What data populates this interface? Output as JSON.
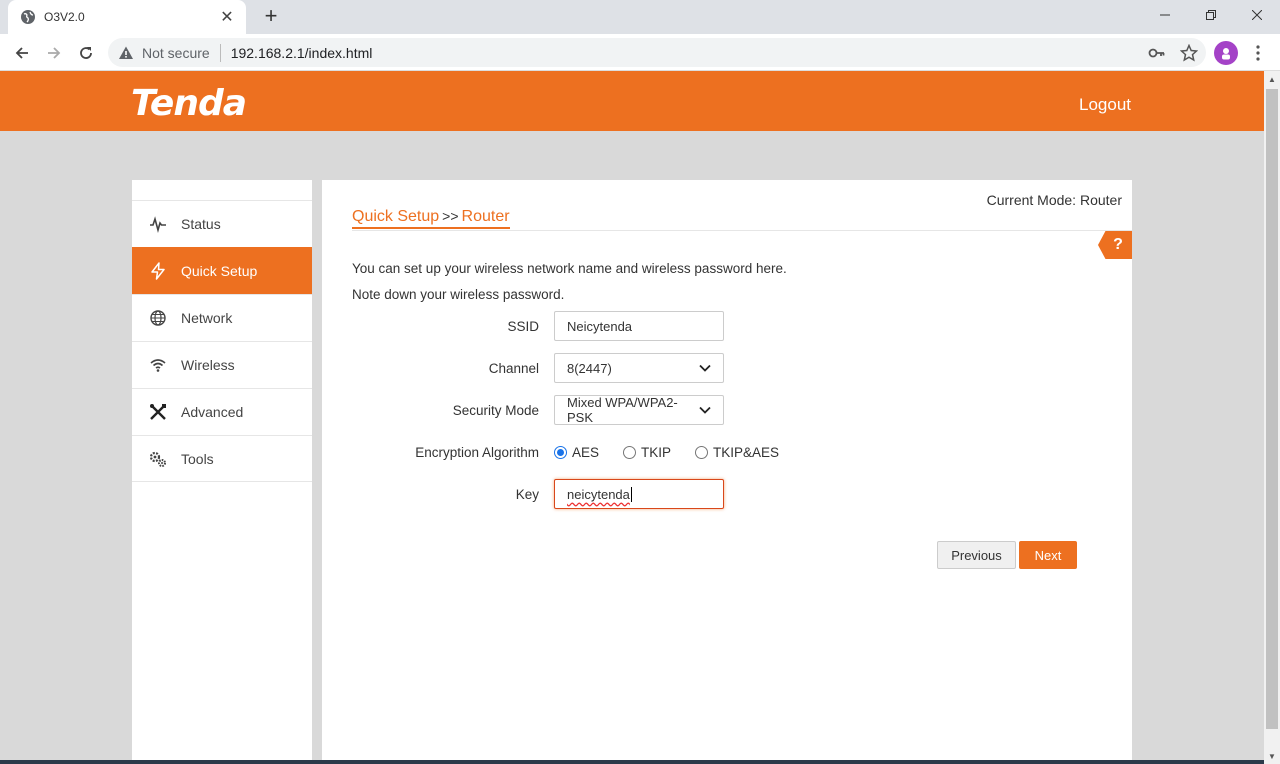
{
  "browser": {
    "tab_title": "O3V2.0",
    "not_secure": "Not secure",
    "url": "192.168.2.1/index.html"
  },
  "header": {
    "logo": "Tenda",
    "logout": "Logout"
  },
  "sidebar": {
    "items": [
      {
        "label": "Status",
        "icon": "pulse-icon"
      },
      {
        "label": "Quick Setup",
        "icon": "lightning-icon",
        "active": true
      },
      {
        "label": "Network",
        "icon": "globe-icon"
      },
      {
        "label": "Wireless",
        "icon": "wifi-icon"
      },
      {
        "label": "Advanced",
        "icon": "tools-cross-icon"
      },
      {
        "label": "Tools",
        "icon": "gears-icon"
      }
    ]
  },
  "main": {
    "mode": "Current Mode: Router",
    "breadcrumb": {
      "parent": "Quick Setup",
      "sep": ">>",
      "current": "Router"
    },
    "help": "?",
    "desc1": "You can set up your wireless network name and wireless password here.",
    "desc2": "Note down your wireless password.",
    "form": {
      "ssid_label": "SSID",
      "ssid_value": "Neicytenda",
      "channel_label": "Channel",
      "channel_value": "8(2447)",
      "security_label": "Security Mode",
      "security_value": "Mixed WPA/WPA2-PSK",
      "encryption_label": "Encryption Algorithm",
      "encryption_options": [
        "AES",
        "TKIP",
        "TKIP&AES"
      ],
      "encryption_selected": "AES",
      "key_label": "Key",
      "key_value": "neicytenda"
    },
    "buttons": {
      "previous": "Previous",
      "next": "Next"
    }
  },
  "colors": {
    "brand": "#ed7020",
    "header_bg": "#ed7020",
    "page_bg": "#d9d9d9"
  }
}
